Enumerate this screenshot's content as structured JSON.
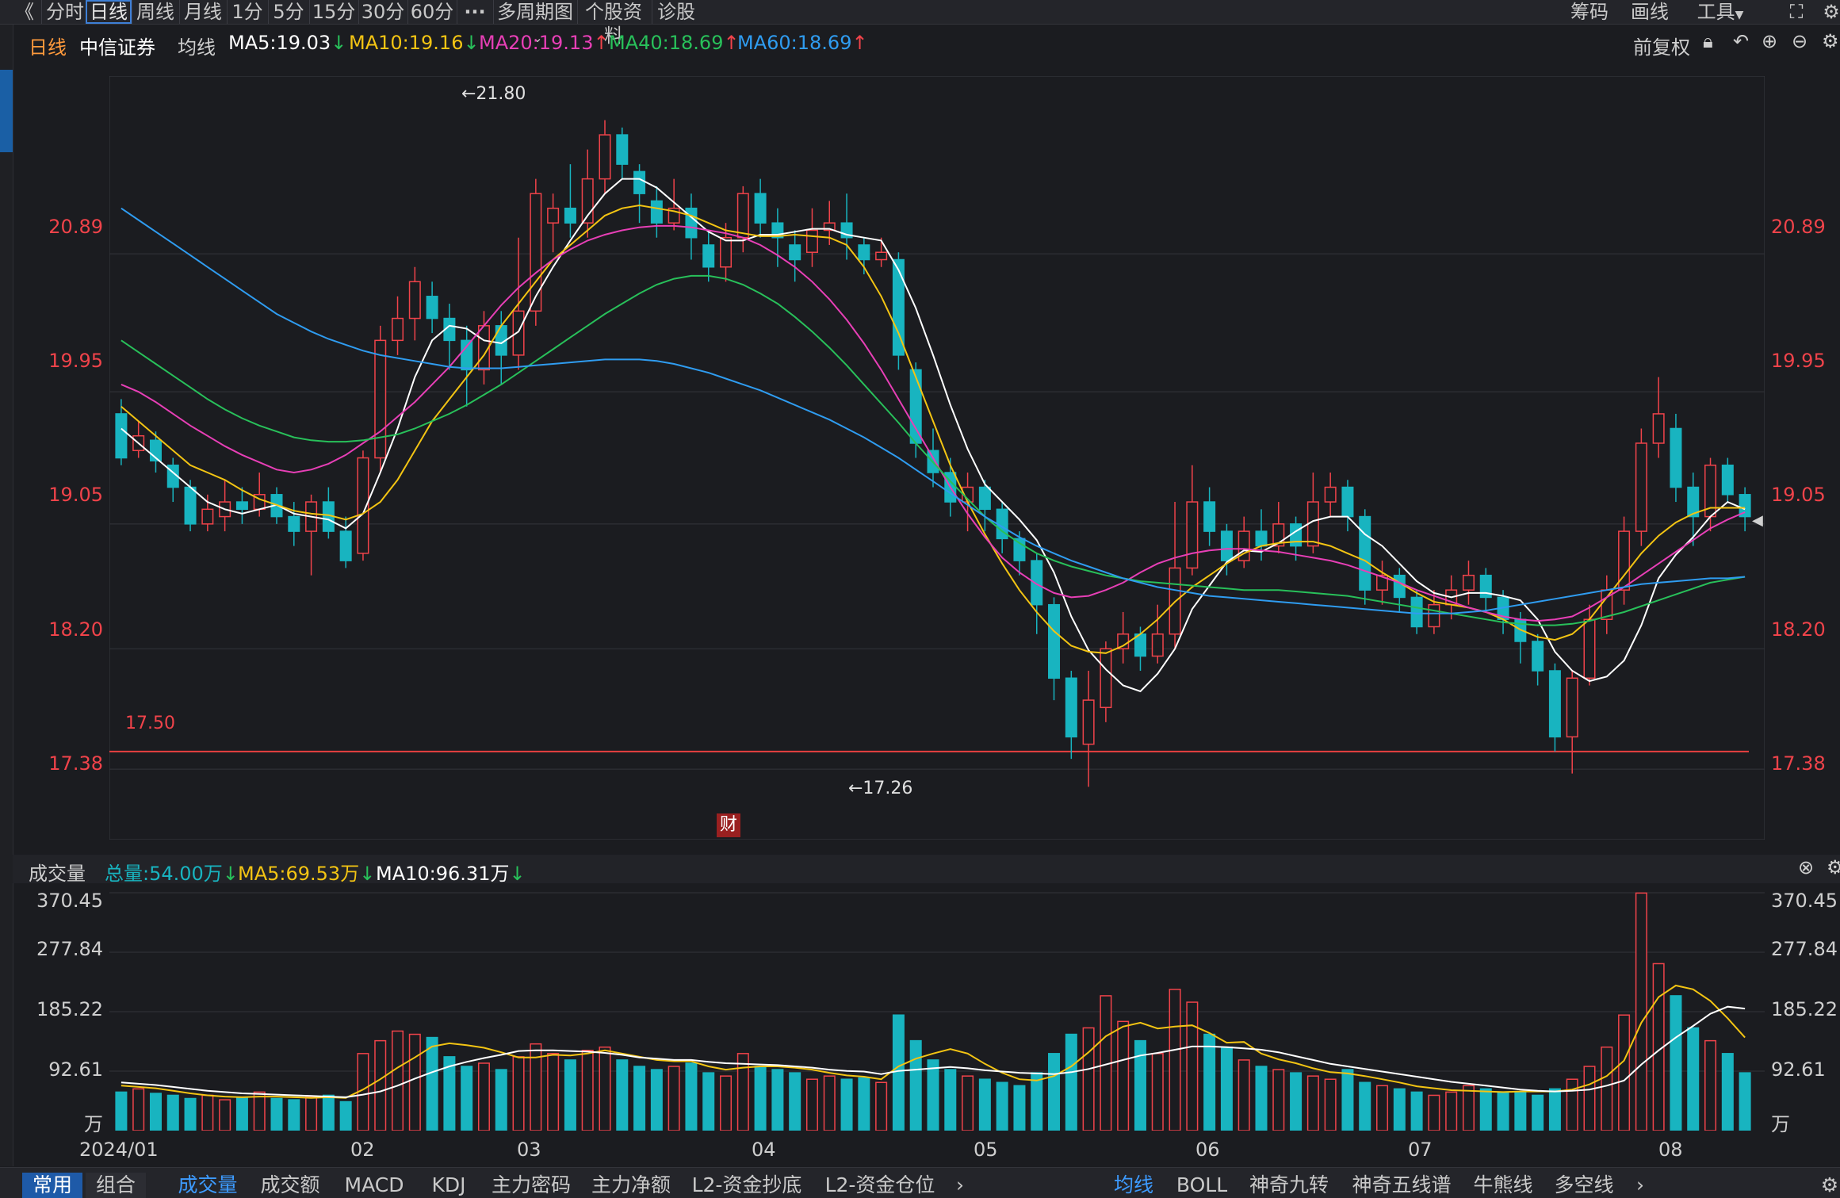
{
  "toolbar": {
    "back": "《",
    "tabs": [
      "分时",
      "日线",
      "周线",
      "月线",
      "1分",
      "5分",
      "15分",
      "30分",
      "60分",
      "···",
      "多周期图",
      "个股资料",
      "诊股"
    ],
    "right": [
      "筹码",
      "画线",
      "工具"
    ]
  },
  "header": {
    "period": "日线",
    "stock": "中信证券",
    "ma_label": "均线",
    "ma5": "MA5:19.03",
    "ma10": "MA10:19.16",
    "ma20": "MA20:19.13",
    "ma40": "MA40:18.69",
    "ma60": "MA60:18.69",
    "adjust": "前复权"
  },
  "price_axis": [
    "20.89",
    "19.95",
    "19.05",
    "18.20",
    "17.38"
  ],
  "annotations": {
    "high": "←21.80",
    "low": "←17.26",
    "line_label": "17.50",
    "finance_badge": "财"
  },
  "volume_header": {
    "title": "成交量",
    "total": "总量:54.00万",
    "ma5": "MA5:69.53万",
    "ma10": "MA10:96.31万"
  },
  "volume_axis": [
    "370.45",
    "277.84",
    "185.22",
    "92.61",
    "万"
  ],
  "x_axis": [
    "2024/01",
    "02",
    "03",
    "04",
    "05",
    "06",
    "07",
    "08"
  ],
  "bottom_left": [
    "常用",
    "组合"
  ],
  "bottom_tabs": [
    "成交量",
    "成交额",
    "MACD",
    "KDJ",
    "主力密码",
    "主力净额",
    "L2-资金抄底",
    "L2-资金仓位"
  ],
  "bottom_right": [
    "均线",
    "BOLL",
    "神奇九转",
    "神奇五线谱",
    "牛熊线",
    "多空线"
  ],
  "colors": {
    "up": "#f0434a",
    "down": "#18b4c0",
    "ma5": "#ffffff",
    "ma10": "#f3c413",
    "ma20": "#e73fb6",
    "ma40": "#28c05a",
    "ma60": "#2f9cf0",
    "hline": "#e84040"
  },
  "chart_data": {
    "type": "candlestick",
    "y_range": [
      16.9,
      22.1
    ],
    "support_line": 17.5,
    "candles": [
      [
        19.8,
        19.5,
        19.9,
        19.45
      ],
      [
        19.55,
        19.65,
        19.75,
        19.5
      ],
      [
        19.62,
        19.48,
        19.68,
        19.4
      ],
      [
        19.45,
        19.3,
        19.5,
        19.2
      ],
      [
        19.3,
        19.05,
        19.35,
        19.0
      ],
      [
        19.05,
        19.15,
        19.25,
        19.0
      ],
      [
        19.1,
        19.2,
        19.35,
        19.0
      ],
      [
        19.2,
        19.15,
        19.3,
        19.05
      ],
      [
        19.15,
        19.25,
        19.4,
        19.1
      ],
      [
        19.25,
        19.1,
        19.3,
        19.05
      ],
      [
        19.1,
        19.0,
        19.2,
        18.9
      ],
      [
        19.0,
        19.2,
        19.25,
        18.7
      ],
      [
        19.2,
        19.0,
        19.3,
        18.95
      ],
      [
        19.0,
        18.8,
        19.1,
        18.75
      ],
      [
        18.85,
        19.5,
        19.55,
        18.8
      ],
      [
        19.5,
        20.3,
        20.4,
        19.4
      ],
      [
        20.3,
        20.45,
        20.6,
        20.2
      ],
      [
        20.45,
        20.7,
        20.8,
        20.3
      ],
      [
        20.6,
        20.45,
        20.7,
        20.35
      ],
      [
        20.45,
        20.3,
        20.55,
        20.1
      ],
      [
        20.3,
        20.1,
        20.4,
        19.85
      ],
      [
        20.1,
        20.4,
        20.5,
        20.0
      ],
      [
        20.4,
        20.2,
        20.5,
        20.0
      ],
      [
        20.2,
        20.5,
        21.0,
        20.1
      ],
      [
        20.5,
        21.3,
        21.4,
        20.4
      ],
      [
        21.1,
        21.2,
        21.3,
        20.9
      ],
      [
        21.2,
        21.1,
        21.5,
        21.0
      ],
      [
        21.1,
        21.4,
        21.6,
        21.0
      ],
      [
        21.4,
        21.7,
        21.8,
        21.3
      ],
      [
        21.7,
        21.5,
        21.75,
        21.4
      ],
      [
        21.45,
        21.3,
        21.5,
        21.1
      ],
      [
        21.25,
        21.1,
        21.35,
        21.0
      ],
      [
        21.1,
        21.2,
        21.4,
        21.05
      ],
      [
        21.2,
        21.0,
        21.3,
        20.85
      ],
      [
        20.95,
        20.8,
        21.05,
        20.7
      ],
      [
        20.8,
        21.0,
        21.1,
        20.7
      ],
      [
        21.0,
        21.3,
        21.35,
        20.9
      ],
      [
        21.3,
        21.1,
        21.4,
        21.0
      ],
      [
        21.1,
        21.0,
        21.2,
        20.8
      ],
      [
        20.95,
        20.85,
        21.05,
        20.7
      ],
      [
        20.9,
        21.05,
        21.2,
        20.8
      ],
      [
        21.05,
        21.1,
        21.25,
        20.95
      ],
      [
        21.1,
        21.0,
        21.3,
        20.85
      ],
      [
        20.95,
        20.85,
        21.0,
        20.75
      ],
      [
        20.85,
        20.9,
        21.0,
        20.8
      ],
      [
        20.85,
        20.2,
        20.9,
        20.1
      ],
      [
        20.1,
        19.6,
        20.15,
        19.5
      ],
      [
        19.55,
        19.4,
        19.7,
        19.3
      ],
      [
        19.4,
        19.2,
        19.5,
        19.1
      ],
      [
        19.2,
        19.3,
        19.4,
        19.0
      ],
      [
        19.3,
        19.15,
        19.35,
        19.0
      ],
      [
        19.15,
        18.95,
        19.2,
        18.85
      ],
      [
        18.95,
        18.8,
        19.0,
        18.7
      ],
      [
        18.8,
        18.5,
        18.85,
        18.3
      ],
      [
        18.5,
        18.0,
        18.55,
        17.85
      ],
      [
        18.0,
        17.6,
        18.05,
        17.45
      ],
      [
        17.55,
        17.85,
        18.05,
        17.26
      ],
      [
        17.8,
        18.2,
        18.25,
        17.7
      ],
      [
        18.2,
        18.3,
        18.45,
        18.1
      ],
      [
        18.3,
        18.15,
        18.35,
        18.05
      ],
      [
        18.15,
        18.3,
        18.5,
        18.1
      ],
      [
        18.3,
        18.75,
        19.2,
        18.2
      ],
      [
        18.75,
        19.2,
        19.45,
        18.7
      ],
      [
        19.2,
        19.0,
        19.3,
        18.9
      ],
      [
        19.0,
        18.8,
        19.05,
        18.7
      ],
      [
        18.8,
        19.0,
        19.1,
        18.75
      ],
      [
        19.0,
        18.9,
        19.15,
        18.8
      ],
      [
        18.9,
        19.05,
        19.2,
        18.85
      ],
      [
        19.05,
        18.9,
        19.1,
        18.8
      ],
      [
        18.9,
        19.2,
        19.4,
        18.85
      ],
      [
        19.2,
        19.3,
        19.4,
        19.1
      ],
      [
        19.3,
        19.1,
        19.35,
        19.0
      ],
      [
        19.1,
        18.6,
        19.15,
        18.5
      ],
      [
        18.6,
        18.7,
        18.8,
        18.5
      ],
      [
        18.7,
        18.55,
        18.75,
        18.45
      ],
      [
        18.55,
        18.35,
        18.6,
        18.3
      ],
      [
        18.35,
        18.5,
        18.6,
        18.3
      ],
      [
        18.5,
        18.6,
        18.7,
        18.4
      ],
      [
        18.6,
        18.7,
        18.8,
        18.5
      ],
      [
        18.7,
        18.55,
        18.75,
        18.45
      ],
      [
        18.55,
        18.4,
        18.6,
        18.3
      ],
      [
        18.4,
        18.25,
        18.45,
        18.1
      ],
      [
        18.25,
        18.05,
        18.3,
        17.95
      ],
      [
        18.05,
        17.6,
        18.1,
        17.5
      ],
      [
        17.6,
        18.0,
        18.05,
        17.35
      ],
      [
        18.0,
        18.4,
        18.5,
        17.95
      ],
      [
        18.4,
        18.6,
        18.7,
        18.3
      ],
      [
        18.6,
        19.0,
        19.1,
        18.5
      ],
      [
        19.0,
        19.6,
        19.7,
        18.9
      ],
      [
        19.6,
        19.8,
        20.05,
        19.5
      ],
      [
        19.7,
        19.3,
        19.8,
        19.2
      ],
      [
        19.3,
        19.1,
        19.4,
        18.9
      ],
      [
        19.1,
        19.45,
        19.5,
        19.0
      ],
      [
        19.45,
        19.25,
        19.5,
        19.2
      ],
      [
        19.25,
        19.1,
        19.3,
        19.0
      ]
    ],
    "ma": {
      "ma5": [
        19.7,
        19.6,
        19.5,
        19.4,
        19.3,
        19.2,
        19.15,
        19.12,
        19.15,
        19.18,
        19.12,
        19.1,
        19.08,
        19.02,
        19.12,
        19.4,
        19.7,
        20.05,
        20.3,
        20.4,
        20.38,
        20.3,
        20.28,
        20.36,
        20.6,
        20.8,
        20.98,
        21.15,
        21.3,
        21.4,
        21.4,
        21.34,
        21.24,
        21.14,
        21.04,
        20.98,
        20.98,
        21.02,
        21.02,
        21.04,
        21.06,
        21.06,
        21.02,
        21.0,
        20.98,
        20.78,
        20.52,
        20.2,
        19.86,
        19.56,
        19.32,
        19.2,
        19.08,
        18.94,
        18.72,
        18.42,
        18.19,
        18.06,
        17.95,
        17.91,
        18.03,
        18.2,
        18.47,
        18.63,
        18.79,
        18.87,
        18.86,
        18.92,
        19.0,
        19.07,
        19.1,
        19.1,
        18.98,
        18.9,
        18.78,
        18.66,
        18.58,
        18.55,
        18.58,
        18.58,
        18.56,
        18.53,
        18.4,
        18.18,
        18.05,
        17.98,
        18.01,
        18.12,
        18.36,
        18.68,
        18.84,
        18.96,
        19.1,
        19.2,
        19.15
      ],
      "ma10": [
        19.85,
        19.75,
        19.65,
        19.55,
        19.45,
        19.4,
        19.35,
        19.28,
        19.22,
        19.18,
        19.14,
        19.12,
        19.11,
        19.08,
        19.12,
        19.2,
        19.35,
        19.55,
        19.75,
        19.9,
        20.05,
        20.2,
        20.4,
        20.55,
        20.7,
        20.85,
        20.95,
        21.05,
        21.15,
        21.2,
        21.22,
        21.2,
        21.18,
        21.15,
        21.1,
        21.05,
        21.03,
        21.01,
        21.01,
        21.02,
        21.01,
        21.0,
        20.95,
        20.8,
        20.6,
        20.35,
        20.05,
        19.75,
        19.45,
        19.2,
        18.98,
        18.78,
        18.6,
        18.45,
        18.32,
        18.22,
        18.18,
        18.17,
        18.22,
        18.3,
        18.4,
        18.52,
        18.62,
        18.7,
        18.78,
        18.85,
        18.9,
        18.92,
        18.93,
        18.93,
        18.9,
        18.85,
        18.8,
        18.72,
        18.65,
        18.58,
        18.52,
        18.5,
        18.48,
        18.45,
        18.4,
        18.33,
        18.28,
        18.26,
        18.3,
        18.4,
        18.55,
        18.7,
        18.85,
        18.97,
        19.06,
        19.12,
        19.16,
        19.16,
        19.16
      ],
      "ma20": [
        20.0,
        19.95,
        19.88,
        19.8,
        19.72,
        19.65,
        19.58,
        19.52,
        19.47,
        19.42,
        19.4,
        19.42,
        19.46,
        19.52,
        19.6,
        19.68,
        19.78,
        19.88,
        20.0,
        20.12,
        20.26,
        20.4,
        20.54,
        20.66,
        20.76,
        20.85,
        20.92,
        20.98,
        21.02,
        21.05,
        21.07,
        21.08,
        21.08,
        21.07,
        21.05,
        21.03,
        21.0,
        20.95,
        20.88,
        20.8,
        20.7,
        20.58,
        20.44,
        20.28,
        20.1,
        19.9,
        19.7,
        19.5,
        19.3,
        19.12,
        18.96,
        18.82,
        18.72,
        18.64,
        18.58,
        18.55,
        18.56,
        18.6,
        18.65,
        18.72,
        18.78,
        18.82,
        18.85,
        18.87,
        18.88,
        18.88,
        18.87,
        18.86,
        18.84,
        18.82,
        18.8,
        18.77,
        18.73,
        18.69,
        18.65,
        18.6,
        18.56,
        18.52,
        18.48,
        18.45,
        18.42,
        18.4,
        18.39,
        18.4,
        18.42,
        18.48,
        18.55,
        18.62,
        18.7,
        18.78,
        18.86,
        18.94,
        19.02,
        19.08,
        19.13
      ],
      "ma40": [
        20.3,
        20.22,
        20.14,
        20.06,
        19.98,
        19.9,
        19.83,
        19.77,
        19.72,
        19.68,
        19.64,
        19.62,
        19.61,
        19.61,
        19.62,
        19.64,
        19.66,
        19.7,
        19.75,
        19.8,
        19.86,
        19.93,
        20.0,
        20.08,
        20.16,
        20.24,
        20.32,
        20.4,
        20.48,
        20.55,
        20.62,
        20.68,
        20.72,
        20.74,
        20.74,
        20.72,
        20.68,
        20.62,
        20.55,
        20.46,
        20.36,
        20.25,
        20.13,
        20.0,
        19.87,
        19.74,
        19.6,
        19.47,
        19.34,
        19.22,
        19.1,
        19.0,
        18.92,
        18.85,
        18.8,
        18.76,
        18.73,
        18.7,
        18.68,
        18.66,
        18.65,
        18.64,
        18.63,
        18.62,
        18.61,
        18.6,
        18.6,
        18.6,
        18.59,
        18.58,
        18.57,
        18.56,
        18.54,
        18.52,
        18.5,
        18.48,
        18.46,
        18.44,
        18.42,
        18.4,
        18.38,
        18.37,
        18.36,
        18.36,
        18.37,
        18.39,
        18.42,
        18.45,
        18.49,
        18.53,
        18.57,
        18.61,
        18.65,
        18.67,
        18.69
      ],
      "ma60": [
        21.2,
        21.12,
        21.04,
        20.96,
        20.88,
        20.8,
        20.72,
        20.64,
        20.56,
        20.48,
        20.42,
        20.36,
        20.31,
        20.27,
        20.23,
        20.2,
        20.18,
        20.16,
        20.14,
        20.12,
        20.11,
        20.11,
        20.11,
        20.12,
        20.13,
        20.14,
        20.15,
        20.16,
        20.17,
        20.17,
        20.17,
        20.16,
        20.14,
        20.11,
        20.08,
        20.04,
        20.0,
        19.96,
        19.91,
        19.86,
        19.81,
        19.76,
        19.7,
        19.64,
        19.57,
        19.5,
        19.42,
        19.34,
        19.26,
        19.18,
        19.1,
        19.03,
        18.96,
        18.9,
        18.85,
        18.8,
        18.76,
        18.72,
        18.68,
        18.65,
        18.62,
        18.6,
        18.58,
        18.56,
        18.55,
        18.54,
        18.53,
        18.52,
        18.51,
        18.5,
        18.49,
        18.48,
        18.47,
        18.46,
        18.45,
        18.44,
        18.44,
        18.44,
        18.45,
        18.46,
        18.48,
        18.5,
        18.52,
        18.54,
        18.56,
        18.58,
        18.6,
        18.62,
        18.64,
        18.65,
        18.66,
        18.67,
        18.68,
        18.68,
        18.69
      ]
    },
    "volume": {
      "y_range": [
        0,
        370.45
      ],
      "values": [
        60,
        65,
        58,
        55,
        50,
        55,
        48,
        52,
        60,
        50,
        48,
        52,
        55,
        45,
        120,
        140,
        155,
        150,
        145,
        115,
        100,
        105,
        95,
        115,
        135,
        120,
        110,
        125,
        130,
        110,
        100,
        95,
        100,
        105,
        90,
        85,
        120,
        100,
        95,
        90,
        80,
        85,
        80,
        82,
        75,
        180,
        140,
        110,
        95,
        85,
        80,
        75,
        70,
        90,
        120,
        150,
        160,
        210,
        170,
        140,
        120,
        220,
        200,
        150,
        130,
        110,
        100,
        95,
        90,
        85,
        80,
        95,
        75,
        70,
        65,
        60,
        55,
        60,
        70,
        65,
        60,
        60,
        55,
        65,
        80,
        100,
        130,
        180,
        370,
        260,
        210,
        160,
        140,
        120,
        90
      ],
      "ma5": [
        70,
        68,
        66,
        62,
        58,
        55,
        53,
        52,
        53,
        53,
        52,
        51,
        52,
        51,
        64,
        80,
        98,
        114,
        131,
        136,
        133,
        129,
        122,
        114,
        114,
        118,
        117,
        120,
        125,
        120,
        115,
        110,
        108,
        108,
        100,
        95,
        98,
        100,
        100,
        98,
        95,
        90,
        86,
        84,
        80,
        100,
        112,
        120,
        127,
        120,
        104,
        90,
        80,
        78,
        85,
        100,
        122,
        147,
        162,
        168,
        159,
        162,
        164,
        152,
        137,
        138,
        120,
        111,
        105,
        97,
        91,
        89,
        85,
        80,
        75,
        69,
        66,
        63,
        62,
        61,
        60,
        61,
        61,
        61,
        64,
        72,
        85,
        109,
        168,
        208,
        226,
        220,
        202,
        175,
        145
      ],
      "ma10": [
        75,
        73,
        71,
        68,
        65,
        62,
        60,
        58,
        57,
        56,
        55,
        54,
        53,
        52,
        56,
        61,
        70,
        81,
        91,
        100,
        107,
        113,
        118,
        124,
        125,
        125,
        124,
        123,
        121,
        118,
        114,
        112,
        110,
        110,
        107,
        105,
        104,
        103,
        102,
        100,
        98,
        95,
        93,
        92,
        88,
        93,
        95,
        97,
        99,
        97,
        94,
        92,
        90,
        89,
        88,
        91,
        96,
        103,
        110,
        117,
        121,
        126,
        131,
        131,
        130,
        128,
        126,
        122,
        116,
        110,
        104,
        100,
        96,
        92,
        88,
        84,
        80,
        76,
        73,
        70,
        67,
        64,
        62,
        61,
        62,
        64,
        70,
        78,
        103,
        125,
        145,
        163,
        182,
        193,
        190
      ]
    }
  }
}
